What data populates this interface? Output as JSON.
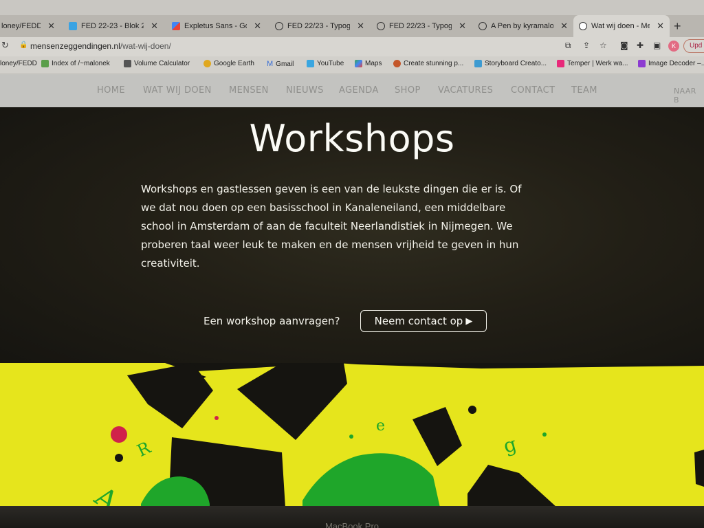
{
  "browser": {
    "tabs": [
      {
        "title": "loney/FEDD",
        "active": false
      },
      {
        "title": "FED 22-23 - Blok 2 -",
        "active": false
      },
      {
        "title": "Expletus Sans - Goog",
        "active": false
      },
      {
        "title": "FED 22/23 - Typograf",
        "active": false
      },
      {
        "title": "FED 22/23 - Typograf",
        "active": false
      },
      {
        "title": "A Pen by kyramaloney",
        "active": false
      },
      {
        "title": "Wat wij doen - Mense",
        "active": true
      }
    ],
    "new_tab": "+",
    "url_host": "mensenzeggendingen.nl",
    "url_path": "/wat-wij-doen/",
    "avatar_letter": "K",
    "update_label": "Upd",
    "bookmarks": [
      {
        "label": "loney/FEDD"
      },
      {
        "label": "Index of /~malonek"
      },
      {
        "label": "Volume Calculator"
      },
      {
        "label": "Google Earth"
      },
      {
        "label": "Gmail"
      },
      {
        "label": "YouTube"
      },
      {
        "label": "Maps"
      },
      {
        "label": "Create stunning p..."
      },
      {
        "label": "Storyboard Creato..."
      },
      {
        "label": "Temper | Werk wa..."
      },
      {
        "label": "Image Decoder –..."
      }
    ]
  },
  "site": {
    "nav": [
      "HOME",
      "WAT WIJ DOEN",
      "MENSEN",
      "NIEUWS",
      "AGENDA",
      "SHOP",
      "VACATURES",
      "CONTACT",
      "TEAM",
      "NAAR B"
    ],
    "title": "Workshops",
    "intro_lines": [
      "Workshops en gastlessen geven is een van de leukste dingen die er is. Of",
      "we dat nou doen op een basisschool in Kanaleneiland, een middelbare",
      "school in Amsterdam of aan de faculteit Neerlandistiek in Nijmegen. We",
      "proberen taal weer leuk te maken en de mensen vrijheid te geven in hun",
      "creativiteit."
    ],
    "cta_label": "Een workshop aanvragen?",
    "cta_button": "Neem contact op",
    "art_letters": [
      "R",
      "e",
      "g",
      "A"
    ]
  },
  "device": {
    "bezel_label": "MacBook Pro"
  },
  "colors": {
    "art_yellow": "#e6e51c",
    "art_green": "#1fa62a",
    "art_red": "#d0224a",
    "art_black": "#151410"
  }
}
